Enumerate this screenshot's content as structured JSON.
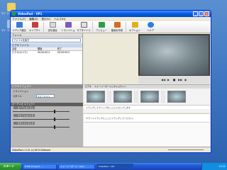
{
  "desktop": {
    "icons": [
      {
        "label": "マイ ドキュメント"
      },
      {
        "label": "マイ コンピュータ"
      }
    ]
  },
  "window": {
    "title": "VideoPad - VP1",
    "menu": [
      "ファイル(F)",
      "編集(E)",
      "表示(V)",
      "ヘルプ(H)"
    ],
    "toolbar": [
      {
        "label": "メディア追加",
        "icon": "add-media-icon"
      },
      {
        "label": "キャプチャ",
        "icon": "capture-icon"
      },
      {
        "label": "空を追加",
        "icon": "add-blank-icon"
      },
      {
        "label": "トランジション",
        "icon": "transition-icon"
      },
      {
        "label": "サブタイトル",
        "icon": "subtitle-icon"
      },
      {
        "label": "プレビュー",
        "icon": "preview-icon"
      },
      {
        "label": "動画を作成",
        "icon": "make-movie-icon"
      },
      {
        "label": "オプション",
        "icon": "options-icon"
      },
      {
        "label": "ヘルプ",
        "icon": "help-icon"
      }
    ],
    "left": {
      "header": "ファイル",
      "field": "ファイルを探す",
      "group": "ビデオファイル",
      "columns": [
        "名前",
        "開始",
        "終了"
      ],
      "rows": [
        [
          "ビデオ(カメラ)",
          "00:00:00.0",
          "00:00:05.0"
        ]
      ],
      "effect_header": "ビデオエフェクト",
      "effect_rows": [
        {
          "label": "トランジション",
          "value": ""
        },
        {
          "label": "スタイル",
          "value": "フェードイン"
        }
      ],
      "audio_header": "オーディオ エフェクト",
      "audio_sub": [
        "オーディオトラック",
        "ナレーショントラック",
        "サウンドトラック"
      ]
    },
    "storyboard": {
      "header": [
        "ビデオ",
        "ストーリーボードとタイムライン"
      ],
      "track_label": "ドラッグしてクリップをここにドロップします",
      "audio_label": "サウンドトラックにここにドラッグしてください。"
    },
    "status": "VideoPad v 2.41 (c) NCH Software"
  },
  "taskbar": {
    "start": "スタート",
    "items": [
      "HTML Project1 - ...",
      "ストーリーボード - Sha...",
      "VideoPad - VP1"
    ],
    "active_index": 2,
    "clock": "13:32"
  },
  "colors": {
    "title_bar": "#0a5fe0",
    "taskbar": "#245edc",
    "start_button": "#2f9b2f"
  }
}
